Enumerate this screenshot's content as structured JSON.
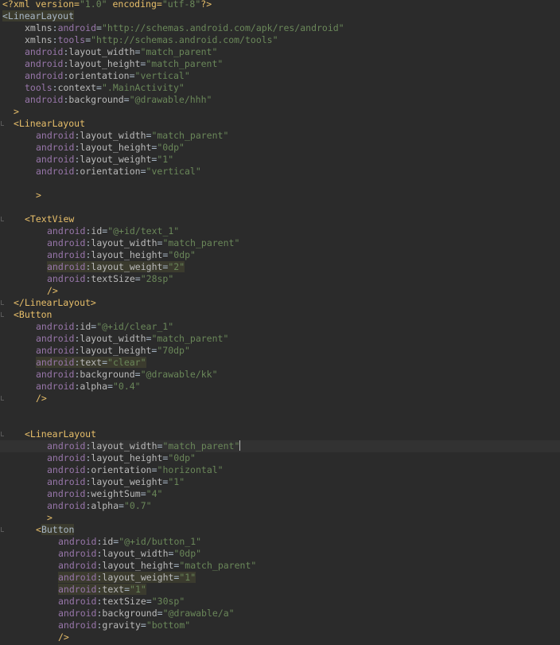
{
  "editor": {
    "language": "xml",
    "caret_line": 37,
    "lines": [
      {
        "indent": 0,
        "tokens": [
          [
            "pi",
            "<?xml version="
          ],
          [
            "str",
            "\"1.0\""
          ],
          [
            "pi",
            " encoding="
          ],
          [
            "str",
            "\"utf-8\""
          ],
          [
            "pi",
            "?>"
          ]
        ]
      },
      {
        "indent": 0,
        "tokens": [
          [
            "taghl",
            "<LinearLayout"
          ]
        ]
      },
      {
        "indent": 4,
        "tokens": [
          [
            "attr",
            "xmlns"
          ],
          [
            "eq",
            ":"
          ],
          [
            "ns",
            "android"
          ],
          [
            "eq",
            "="
          ],
          [
            "str",
            "\"http://schemas.android.com/apk/res/android\""
          ]
        ]
      },
      {
        "indent": 4,
        "tokens": [
          [
            "attr",
            "xmlns"
          ],
          [
            "eq",
            ":"
          ],
          [
            "ns",
            "tools"
          ],
          [
            "eq",
            "="
          ],
          [
            "str",
            "\"http://schemas.android.com/tools\""
          ]
        ]
      },
      {
        "indent": 4,
        "tokens": [
          [
            "ns",
            "android"
          ],
          [
            "eq",
            ":"
          ],
          [
            "attr",
            "layout_width"
          ],
          [
            "eq",
            "="
          ],
          [
            "str",
            "\"match_parent\""
          ]
        ]
      },
      {
        "indent": 4,
        "tokens": [
          [
            "ns",
            "android"
          ],
          [
            "eq",
            ":"
          ],
          [
            "attr",
            "layout_height"
          ],
          [
            "eq",
            "="
          ],
          [
            "str",
            "\"match_parent\""
          ]
        ]
      },
      {
        "indent": 4,
        "tokens": [
          [
            "ns",
            "android"
          ],
          [
            "eq",
            ":"
          ],
          [
            "attr",
            "orientation"
          ],
          [
            "eq",
            "="
          ],
          [
            "str",
            "\"vertical\""
          ]
        ]
      },
      {
        "indent": 4,
        "tokens": [
          [
            "ns",
            "tools"
          ],
          [
            "eq",
            ":"
          ],
          [
            "attr",
            "context"
          ],
          [
            "eq",
            "="
          ],
          [
            "str",
            "\".MainActivity\""
          ]
        ]
      },
      {
        "indent": 4,
        "tokens": [
          [
            "ns",
            "android"
          ],
          [
            "eq",
            ":"
          ],
          [
            "attr",
            "background"
          ],
          [
            "eq",
            "="
          ],
          [
            "str",
            "\"@drawable/hhh\""
          ]
        ]
      },
      {
        "indent": 2,
        "tokens": [
          [
            "tag",
            ">"
          ]
        ]
      },
      {
        "indent": 2,
        "marker": true,
        "tokens": [
          [
            "tag",
            "<LinearLayout"
          ]
        ]
      },
      {
        "indent": 6,
        "tokens": [
          [
            "ns",
            "android"
          ],
          [
            "eq",
            ":"
          ],
          [
            "attr",
            "layout_width"
          ],
          [
            "eq",
            "="
          ],
          [
            "str",
            "\"match_parent\""
          ]
        ]
      },
      {
        "indent": 6,
        "tokens": [
          [
            "ns",
            "android"
          ],
          [
            "eq",
            ":"
          ],
          [
            "attr",
            "layout_height"
          ],
          [
            "eq",
            "="
          ],
          [
            "str",
            "\"0dp\""
          ]
        ]
      },
      {
        "indent": 6,
        "tokens": [
          [
            "ns",
            "android"
          ],
          [
            "eq",
            ":"
          ],
          [
            "attr",
            "layout_weight"
          ],
          [
            "eq",
            "="
          ],
          [
            "str",
            "\"1\""
          ]
        ]
      },
      {
        "indent": 6,
        "tokens": [
          [
            "ns",
            "android"
          ],
          [
            "eq",
            ":"
          ],
          [
            "attr",
            "orientation"
          ],
          [
            "eq",
            "="
          ],
          [
            "str",
            "\"vertical\""
          ]
        ]
      },
      {
        "indent": 0,
        "tokens": []
      },
      {
        "indent": 6,
        "tokens": [
          [
            "tag",
            ">"
          ]
        ]
      },
      {
        "indent": 0,
        "tokens": []
      },
      {
        "indent": 4,
        "marker": true,
        "tokens": [
          [
            "tag",
            "<TextView"
          ]
        ]
      },
      {
        "indent": 8,
        "tokens": [
          [
            "ns",
            "android"
          ],
          [
            "eq",
            ":"
          ],
          [
            "attr",
            "id"
          ],
          [
            "eq",
            "="
          ],
          [
            "str",
            "\"@+id/text_1\""
          ]
        ]
      },
      {
        "indent": 8,
        "tokens": [
          [
            "ns",
            "android"
          ],
          [
            "eq",
            ":"
          ],
          [
            "attr",
            "layout_width"
          ],
          [
            "eq",
            "="
          ],
          [
            "str",
            "\"match_parent\""
          ]
        ]
      },
      {
        "indent": 8,
        "tokens": [
          [
            "ns",
            "android"
          ],
          [
            "eq",
            ":"
          ],
          [
            "attr",
            "layout_height"
          ],
          [
            "eq",
            "="
          ],
          [
            "str",
            "\"0dp\""
          ]
        ]
      },
      {
        "indent": 8,
        "highlight": true,
        "tokens": [
          [
            "ns",
            "android"
          ],
          [
            "eq",
            ":"
          ],
          [
            "attr",
            "layout_weight"
          ],
          [
            "eq",
            "="
          ],
          [
            "str",
            "\"2\""
          ]
        ]
      },
      {
        "indent": 8,
        "tokens": [
          [
            "ns",
            "android"
          ],
          [
            "eq",
            ":"
          ],
          [
            "attr",
            "textSize"
          ],
          [
            "eq",
            "="
          ],
          [
            "str",
            "\"28sp\""
          ]
        ]
      },
      {
        "indent": 8,
        "tokens": [
          [
            "tag",
            "/>"
          ]
        ]
      },
      {
        "indent": 2,
        "marker": true,
        "tokens": [
          [
            "tag",
            "</LinearLayout>"
          ]
        ]
      },
      {
        "indent": 2,
        "marker": true,
        "tokens": [
          [
            "tag",
            "<Button"
          ]
        ]
      },
      {
        "indent": 6,
        "tokens": [
          [
            "ns",
            "android"
          ],
          [
            "eq",
            ":"
          ],
          [
            "attr",
            "id"
          ],
          [
            "eq",
            "="
          ],
          [
            "str",
            "\"@+id/clear_1\""
          ]
        ]
      },
      {
        "indent": 6,
        "tokens": [
          [
            "ns",
            "android"
          ],
          [
            "eq",
            ":"
          ],
          [
            "attr",
            "layout_width"
          ],
          [
            "eq",
            "="
          ],
          [
            "str",
            "\"match_parent\""
          ]
        ]
      },
      {
        "indent": 6,
        "tokens": [
          [
            "ns",
            "android"
          ],
          [
            "eq",
            ":"
          ],
          [
            "attr",
            "layout_height"
          ],
          [
            "eq",
            "="
          ],
          [
            "str",
            "\"70dp\""
          ]
        ]
      },
      {
        "indent": 6,
        "highlight": true,
        "tokens": [
          [
            "ns",
            "android"
          ],
          [
            "eq",
            ":"
          ],
          [
            "attr",
            "text"
          ],
          [
            "eq",
            "="
          ],
          [
            "str",
            "\"clear\""
          ]
        ]
      },
      {
        "indent": 6,
        "tokens": [
          [
            "ns",
            "android"
          ],
          [
            "eq",
            ":"
          ],
          [
            "attr",
            "background"
          ],
          [
            "eq",
            "="
          ],
          [
            "str",
            "\"@drawable/kk\""
          ]
        ]
      },
      {
        "indent": 6,
        "tokens": [
          [
            "ns",
            "android"
          ],
          [
            "eq",
            ":"
          ],
          [
            "attr",
            "alpha"
          ],
          [
            "eq",
            "="
          ],
          [
            "str",
            "\"0.4\""
          ]
        ]
      },
      {
        "indent": 6,
        "marker": true,
        "tokens": [
          [
            "tag",
            "/>"
          ]
        ]
      },
      {
        "indent": 0,
        "tokens": []
      },
      {
        "indent": 0,
        "tokens": []
      },
      {
        "indent": 4,
        "marker": true,
        "tokens": [
          [
            "tag",
            "<LinearLayout"
          ]
        ]
      },
      {
        "indent": 8,
        "tokens": [
          [
            "ns",
            "android"
          ],
          [
            "eq",
            ":"
          ],
          [
            "attr",
            "layout_width"
          ],
          [
            "eq",
            "="
          ],
          [
            "str",
            "\"match_parent\""
          ]
        ]
      },
      {
        "indent": 8,
        "tokens": [
          [
            "ns",
            "android"
          ],
          [
            "eq",
            ":"
          ],
          [
            "attr",
            "layout_height"
          ],
          [
            "eq",
            "="
          ],
          [
            "str",
            "\"0dp\""
          ]
        ]
      },
      {
        "indent": 8,
        "tokens": [
          [
            "ns",
            "android"
          ],
          [
            "eq",
            ":"
          ],
          [
            "attr",
            "orientation"
          ],
          [
            "eq",
            "="
          ],
          [
            "str",
            "\"horizontal\""
          ]
        ]
      },
      {
        "indent": 8,
        "tokens": [
          [
            "ns",
            "android"
          ],
          [
            "eq",
            ":"
          ],
          [
            "attr",
            "layout_weight"
          ],
          [
            "eq",
            "="
          ],
          [
            "str",
            "\"1\""
          ]
        ]
      },
      {
        "indent": 8,
        "tokens": [
          [
            "ns",
            "android"
          ],
          [
            "eq",
            ":"
          ],
          [
            "attr",
            "weightSum"
          ],
          [
            "eq",
            "="
          ],
          [
            "str",
            "\"4\""
          ]
        ]
      },
      {
        "indent": 8,
        "tokens": [
          [
            "ns",
            "android"
          ],
          [
            "eq",
            ":"
          ],
          [
            "attr",
            "alpha"
          ],
          [
            "eq",
            "="
          ],
          [
            "str",
            "\"0.7\""
          ]
        ]
      },
      {
        "indent": 8,
        "tokens": [
          [
            "tag",
            ">"
          ]
        ]
      },
      {
        "indent": 6,
        "marker": true,
        "tokens": [
          [
            "tag",
            "<"
          ],
          [
            "taghl",
            "Button"
          ]
        ]
      },
      {
        "indent": 10,
        "tokens": [
          [
            "ns",
            "android"
          ],
          [
            "eq",
            ":"
          ],
          [
            "attr",
            "id"
          ],
          [
            "eq",
            "="
          ],
          [
            "str",
            "\"@+id/button_1\""
          ]
        ]
      },
      {
        "indent": 10,
        "tokens": [
          [
            "ns",
            "android"
          ],
          [
            "eq",
            ":"
          ],
          [
            "attr",
            "layout_width"
          ],
          [
            "eq",
            "="
          ],
          [
            "str",
            "\"0dp\""
          ]
        ]
      },
      {
        "indent": 10,
        "tokens": [
          [
            "ns",
            "android"
          ],
          [
            "eq",
            ":"
          ],
          [
            "attr",
            "layout_height"
          ],
          [
            "eq",
            "="
          ],
          [
            "str",
            "\"match_parent\""
          ]
        ]
      },
      {
        "indent": 10,
        "highlight": true,
        "tokens": [
          [
            "ns",
            "android"
          ],
          [
            "eq",
            ":"
          ],
          [
            "attr",
            "layout_weight"
          ],
          [
            "eq",
            "="
          ],
          [
            "str",
            "\"1\""
          ]
        ]
      },
      {
        "indent": 10,
        "highlight": true,
        "tokens": [
          [
            "ns",
            "android"
          ],
          [
            "eq",
            ":"
          ],
          [
            "attr",
            "text"
          ],
          [
            "eq",
            "="
          ],
          [
            "str",
            "\"1\""
          ]
        ]
      },
      {
        "indent": 10,
        "tokens": [
          [
            "ns",
            "android"
          ],
          [
            "eq",
            ":"
          ],
          [
            "attr",
            "textSize"
          ],
          [
            "eq",
            "="
          ],
          [
            "str",
            "\"30sp\""
          ]
        ]
      },
      {
        "indent": 10,
        "tokens": [
          [
            "ns",
            "android"
          ],
          [
            "eq",
            ":"
          ],
          [
            "attr",
            "background"
          ],
          [
            "eq",
            "="
          ],
          [
            "str",
            "\"@drawable/a\""
          ]
        ]
      },
      {
        "indent": 10,
        "tokens": [
          [
            "ns",
            "android"
          ],
          [
            "eq",
            ":"
          ],
          [
            "attr",
            "gravity"
          ],
          [
            "eq",
            "="
          ],
          [
            "str",
            "\"bottom\""
          ]
        ]
      },
      {
        "indent": 10,
        "tokens": [
          [
            "tag",
            "/>"
          ]
        ]
      }
    ]
  }
}
